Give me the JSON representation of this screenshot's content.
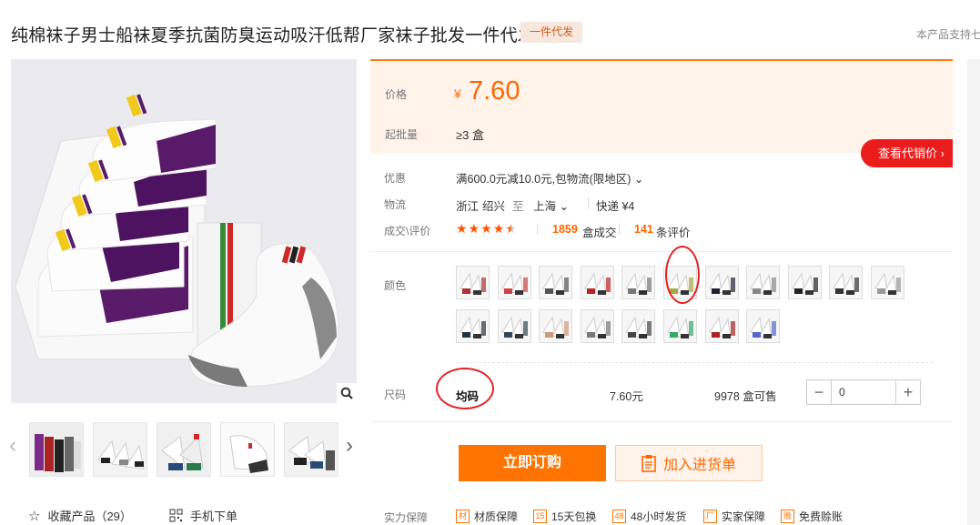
{
  "header": {
    "title": "纯棉袜子男士船袜夏季抗菌防臭运动吸汗低帮厂家袜子批发一件代发",
    "badge": "一件代发",
    "support_note": "本产品支持七"
  },
  "gallery": {
    "thumbnails": [
      "thumb-1",
      "thumb-2",
      "thumb-3",
      "thumb-4",
      "thumb-5"
    ],
    "prev_icon": "‹",
    "next_icon": "›",
    "zoom_icon": "search-icon"
  },
  "bottom_actions": {
    "favorite_label": "收藏产品（29）",
    "mobile_label": "手机下单"
  },
  "pricing": {
    "price_label": "价格",
    "currency": "¥",
    "price": "7.60",
    "moq_label": "起批量",
    "moq_value": "≥3 盒",
    "agent_button": "查看代销价 ›"
  },
  "details": {
    "promo_label": "优惠",
    "promo_value": "满600.0元减10.0元,包物流(限地区) ⌄",
    "logistics_label": "物流",
    "from_prov": "浙江",
    "from_city": "绍兴",
    "to_word": "至",
    "to_city": "上海 ⌄",
    "express": "快递 ¥4",
    "deal_label": "成交\\评价",
    "deals_count": "1859",
    "deals_unit": "盒成交",
    "reviews_count": "141",
    "reviews_unit": "条评价",
    "rating": 4.5
  },
  "colors": {
    "label": "颜色",
    "row1": [
      "#a33",
      "#c44",
      "#555",
      "#b22",
      "#777",
      "#aa4",
      "#223",
      "#888",
      "#222",
      "#333",
      "#999"
    ],
    "row2": [
      "#234",
      "#345",
      "#c97",
      "#777",
      "#444",
      "#3a6",
      "#a22",
      "#56c"
    ]
  },
  "size": {
    "label": "尺码",
    "value": "均码",
    "price": "7.60元",
    "stock": "9978 盒可售",
    "qty": "0",
    "minus": "−",
    "plus": "+"
  },
  "actions": {
    "buy": "立即订购",
    "cart": "加入进货单"
  },
  "guarantees": {
    "label": "实力保障",
    "items": [
      {
        "icon": "材",
        "text": "材质保障"
      },
      {
        "icon": "15",
        "text": "15天包换"
      },
      {
        "icon": "48",
        "text": "48小时发货"
      },
      {
        "icon": "厂",
        "text": "实家保障"
      },
      {
        "icon": "赊",
        "text": "免费赊账"
      }
    ]
  }
}
